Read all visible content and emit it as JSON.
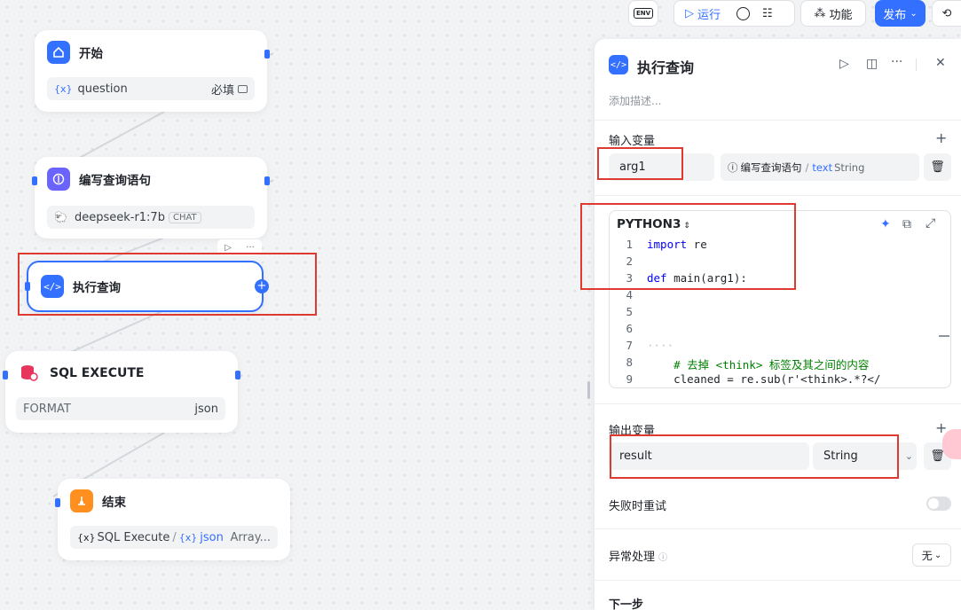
{
  "toolbar": {
    "env_label": "ENV",
    "run_label": "运行",
    "features_label": "功能",
    "publish_label": "发布",
    "accent_color": "#3370ff"
  },
  "canvas": {
    "nodes": {
      "start": {
        "title": "开始",
        "var_name": "question",
        "required": "必填"
      },
      "write_sql": {
        "title": "编写查询语句",
        "model": "deepseek-r1:7b",
        "model_tag": "CHAT"
      },
      "exec_query": {
        "title": "执行查询"
      },
      "sql_execute": {
        "title": "SQL EXECUTE",
        "field_name": "FORMAT",
        "field_value": "json"
      },
      "end": {
        "title": "结束",
        "source_node": "SQL Execute",
        "source_var": "json",
        "type": "Array..."
      }
    },
    "var_symbol": "{x}"
  },
  "panel": {
    "title": "执行查询",
    "description_placeholder": "添加描述...",
    "input_section": "输入变量",
    "input_var_name": "arg1",
    "input_ref_node": "编写查询语句",
    "input_ref_var": "text",
    "input_ref_type": "String",
    "code_lang": "PYTHON3",
    "code_lines": [
      {
        "n": "1",
        "text": "import re"
      },
      {
        "n": "2",
        "text": ""
      },
      {
        "n": "3",
        "text": "def main(arg1):"
      },
      {
        "n": "4",
        "text": ""
      },
      {
        "n": "5",
        "text": ""
      },
      {
        "n": "6",
        "text": ""
      },
      {
        "n": "7",
        "text": "····"
      },
      {
        "n": "8",
        "text": "    # 去掉 <think> 标签及其之间的内容"
      },
      {
        "n": "9",
        "text": "    cleaned = re.sub(r'<think>.*?</"
      }
    ],
    "output_section": "输出变量",
    "output_var_name": "result",
    "output_type": "String",
    "retry_label": "失败时重试",
    "error_label": "异常处理",
    "error_value": "无",
    "next_label": "下一步"
  }
}
